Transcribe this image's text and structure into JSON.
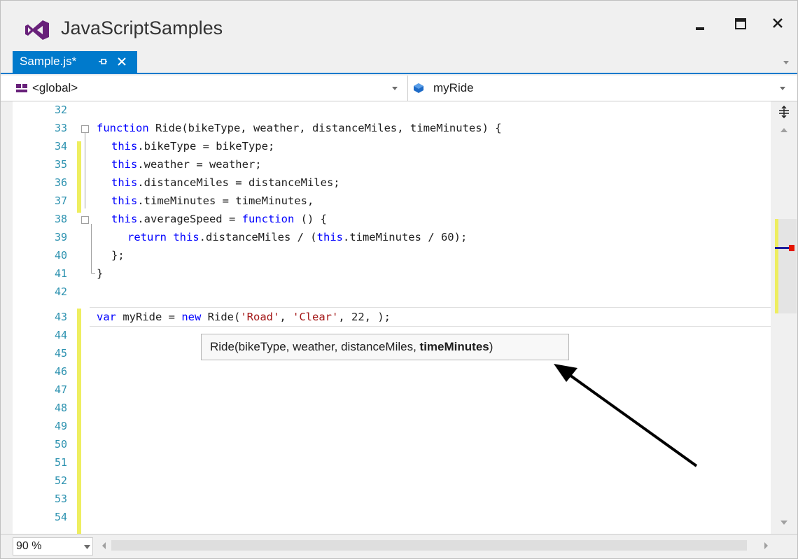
{
  "window": {
    "title": "JavaScriptSamples"
  },
  "tab": {
    "label": "Sample.js*"
  },
  "navbar": {
    "left_value": "<global>",
    "right_value": "myRide"
  },
  "editor": {
    "line_numbers": [
      "32",
      "33",
      "34",
      "35",
      "36",
      "37",
      "38",
      "39",
      "40",
      "41",
      "42",
      "43",
      "44",
      "45",
      "46",
      "47",
      "48",
      "49",
      "50",
      "51",
      "52",
      "53",
      "54"
    ],
    "code": {
      "l33_kw": "function",
      "l33_rest": " Ride(bikeType, weather, distanceMiles, timeMinutes) {",
      "l34_kw": "this",
      "l34_rest": ".bikeType = bikeType;",
      "l35_kw": "this",
      "l35_rest": ".weather = weather;",
      "l36_kw": "this",
      "l36_rest": ".distanceMiles = distanceMiles;",
      "l37_kw": "this",
      "l37_rest": ".timeMinutes = timeMinutes,",
      "l38_kw": "this",
      "l38_mid": ".averageSpeed = ",
      "l38_kw2": "function",
      "l38_rest": " () {",
      "l39_kw": "return",
      "l39_sp": " ",
      "l39_kw2": "this",
      "l39_mid": ".distanceMiles / (",
      "l39_kw3": "this",
      "l39_rest": ".timeMinutes / 60);",
      "l40": "};",
      "l41": "}",
      "l43_kw": "var",
      "l43_mid": " myRide = ",
      "l43_kw2": "new",
      "l43_mid2": " Ride(",
      "l43_str1": "'Road'",
      "l43_sep": ", ",
      "l43_str2": "'Clear'",
      "l43_rest": ", 22, );"
    },
    "tooltip": {
      "prefix": "Ride(bikeType, weather, distanceMiles, ",
      "current_param": "timeMinutes",
      "suffix": ")"
    }
  },
  "statusbar": {
    "zoom": "90 %"
  },
  "icons": {
    "logo": "visual-studio-logo-icon",
    "minimize": "minimize-icon",
    "maximize": "maximize-icon",
    "close": "close-icon",
    "pin": "pin-icon",
    "tab_close": "close-icon",
    "scope": "scope-icon",
    "member": "member-icon"
  },
  "colors": {
    "accent": "#007acc",
    "keyword": "#0000ff",
    "string": "#a31515",
    "line_number": "#2b91af",
    "change_marker": "#eeee60",
    "logo": "#68217a"
  }
}
